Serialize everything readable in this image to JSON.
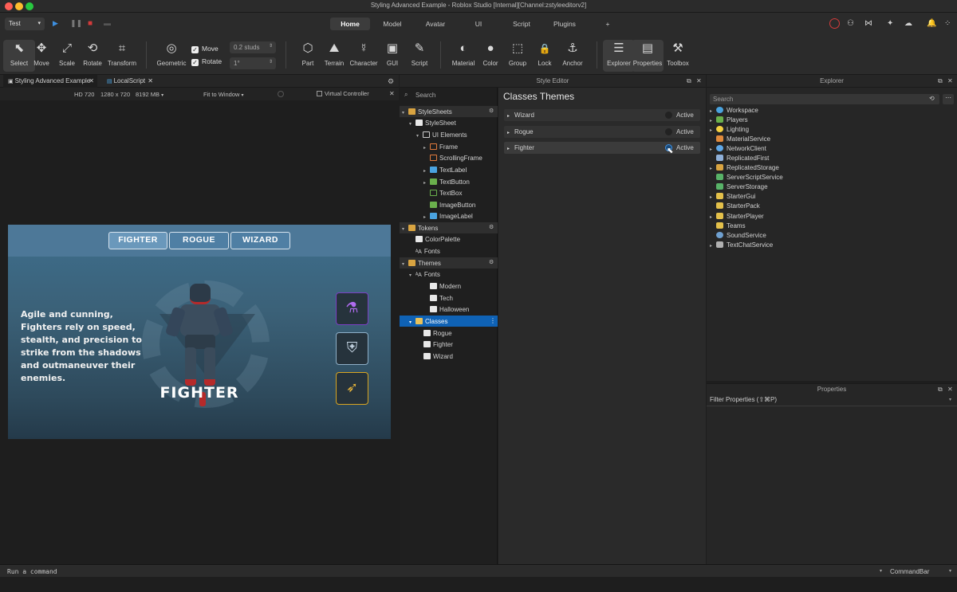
{
  "window": {
    "title": "Styling Advanced Example - Roblox Studio [Internal][Channel:zstyleeditorv2]"
  },
  "toolbar": {
    "mode_select": "Test",
    "tabs": [
      {
        "label": "Home",
        "active": true
      },
      {
        "label": "Model"
      },
      {
        "label": "Avatar"
      },
      {
        "label": "UI"
      },
      {
        "label": "Script"
      },
      {
        "label": "Plugins"
      },
      {
        "label": "+"
      }
    ],
    "tools_a": [
      {
        "label": "Select",
        "icon": "cursor-icon",
        "glyph": "⬉"
      },
      {
        "label": "Move",
        "icon": "move-arrows-icon",
        "glyph": "✥"
      },
      {
        "label": "Scale",
        "icon": "scale-icon",
        "glyph": "⤢"
      },
      {
        "label": "Rotate",
        "icon": "rotate-icon",
        "glyph": "⟲"
      },
      {
        "label": "Transform",
        "icon": "transform-icon",
        "glyph": "⌗"
      },
      {
        "label": "Geometric",
        "icon": "geometric-icon",
        "glyph": "◎"
      }
    ],
    "move_label": "Move",
    "rotate_label": "Rotate",
    "move_studs": "0.2 studs",
    "rotate_deg": "1°",
    "tools_b": [
      {
        "label": "Part",
        "icon": "part-cube-icon",
        "glyph": "⬡"
      },
      {
        "label": "Terrain",
        "icon": "terrain-icon",
        "glyph": "⛰"
      },
      {
        "label": "Character",
        "icon": "character-icon",
        "glyph": "☿"
      },
      {
        "label": "GUI",
        "icon": "gui-icon",
        "glyph": "▣"
      },
      {
        "label": "Script",
        "icon": "script-icon",
        "glyph": "✎"
      },
      {
        "label": "Material",
        "icon": "material-icon",
        "glyph": "◐"
      },
      {
        "label": "Color",
        "icon": "color-icon",
        "glyph": "●"
      },
      {
        "label": "Group",
        "icon": "group-icon",
        "glyph": "⬚"
      },
      {
        "label": "Lock",
        "icon": "lock-icon",
        "glyph": "🔒"
      },
      {
        "label": "Anchor",
        "icon": "anchor-icon",
        "glyph": "⚓"
      },
      {
        "label": "Explorer",
        "icon": "explorer-icon",
        "glyph": "☰"
      },
      {
        "label": "Properties",
        "icon": "properties-icon",
        "glyph": "▤"
      },
      {
        "label": "Toolbox",
        "icon": "toolbox-icon",
        "glyph": "⚒"
      }
    ]
  },
  "viewport": {
    "tabs": [
      {
        "label": "Styling Advanced Example",
        "active": true
      },
      {
        "label": "LocalScript"
      }
    ],
    "info": {
      "resolution": "HD 720",
      "size": "1280 x 720",
      "memory": "8192 MB",
      "fit": "Fit to Window",
      "virtual_controller": "Virtual Controller"
    },
    "game": {
      "buttons": [
        "FIGHTER",
        "ROGUE",
        "WIZARD"
      ],
      "description": "Agile and cunning, Fighters rely on speed, stealth, and precision to strike from the shadows and outmaneuver their enemies.",
      "character_name": "FIGHTER",
      "class_icons": [
        "potion-icon",
        "shield-icon",
        "bow-icon"
      ]
    }
  },
  "style_editor": {
    "header": "Style Editor",
    "search_placeholder": "Search",
    "tree": [
      {
        "label": "StyleSheets",
        "level": 0,
        "caret": "▾",
        "header": true
      },
      {
        "label": "StyleSheet",
        "level": 1,
        "caret": "▾"
      },
      {
        "label": "UI Elements",
        "level": 2,
        "caret": "▾"
      },
      {
        "label": "Frame",
        "level": 3,
        "caret": "▸"
      },
      {
        "label": "ScrollingFrame",
        "level": 3,
        "caret": ""
      },
      {
        "label": "TextLabel",
        "level": 3,
        "caret": "▸"
      },
      {
        "label": "TextButton",
        "level": 3,
        "caret": "▸"
      },
      {
        "label": "TextBox",
        "level": 3,
        "caret": ""
      },
      {
        "label": "ImageButton",
        "level": 3,
        "caret": ""
      },
      {
        "label": "ImageLabel",
        "level": 3,
        "caret": "▸"
      },
      {
        "label": "Tokens",
        "level": 0,
        "caret": "▾",
        "header": true
      },
      {
        "label": "ColorPalette",
        "level": 1,
        "caret": ""
      },
      {
        "label": "Fonts",
        "level": 1,
        "caret": ""
      },
      {
        "label": "Themes",
        "level": 0,
        "caret": "▾",
        "header": true
      },
      {
        "label": "Fonts",
        "level": 1,
        "caret": "▾"
      },
      {
        "label": "Modern",
        "level": 2,
        "caret": ""
      },
      {
        "label": "Tech",
        "level": 2,
        "caret": ""
      },
      {
        "label": "Halloween",
        "level": 2,
        "caret": ""
      },
      {
        "label": "Classes",
        "level": 1,
        "caret": "▾",
        "selected": true
      },
      {
        "label": "Rogue",
        "level": 2,
        "caret": ""
      },
      {
        "label": "Fighter",
        "level": 2,
        "caret": ""
      },
      {
        "label": "Wizard",
        "level": 2,
        "caret": ""
      }
    ],
    "title": "Classes Themes",
    "themes": [
      {
        "label": "Wizard",
        "status": "Active"
      },
      {
        "label": "Rogue",
        "status": "Active"
      },
      {
        "label": "Fighter",
        "status": "Active"
      }
    ]
  },
  "explorer": {
    "header": "Explorer",
    "search_placeholder": "Search",
    "items": [
      {
        "label": "Workspace",
        "caret": "▸",
        "color": "#4aa3df"
      },
      {
        "label": "Players",
        "caret": "▸",
        "color": "#6ab04c"
      },
      {
        "label": "Lighting",
        "caret": "▸",
        "color": "#f5d142"
      },
      {
        "label": "MaterialService",
        "caret": "",
        "color": "#e08a3c"
      },
      {
        "label": "NetworkClient",
        "caret": "▸",
        "color": "#5fa8e8"
      },
      {
        "label": "ReplicatedFirst",
        "caret": "",
        "color": "#8fb0d8"
      },
      {
        "label": "ReplicatedStorage",
        "caret": "▸",
        "color": "#d9a441"
      },
      {
        "label": "ServerScriptService",
        "caret": "",
        "color": "#58b368"
      },
      {
        "label": "ServerStorage",
        "caret": "",
        "color": "#58b368"
      },
      {
        "label": "StarterGui",
        "caret": "▸",
        "color": "#e3c04a"
      },
      {
        "label": "StarterPack",
        "caret": "",
        "color": "#e3c04a"
      },
      {
        "label": "StarterPlayer",
        "caret": "▸",
        "color": "#e3c04a"
      },
      {
        "label": "Teams",
        "caret": "",
        "color": "#e3c04a"
      },
      {
        "label": "SoundService",
        "caret": "",
        "color": "#6fa0d0"
      },
      {
        "label": "TextChatService",
        "caret": "▸",
        "color": "#b0b0b0"
      }
    ]
  },
  "properties": {
    "header": "Properties",
    "filter_placeholder": "Filter Properties (⇧⌘P)"
  },
  "command_bar": {
    "placeholder": "Run a command",
    "label": "CommandBar"
  },
  "colors": {
    "selection": "#0f62b5",
    "record": "#d33b3b",
    "play": "#3d8fe0"
  }
}
